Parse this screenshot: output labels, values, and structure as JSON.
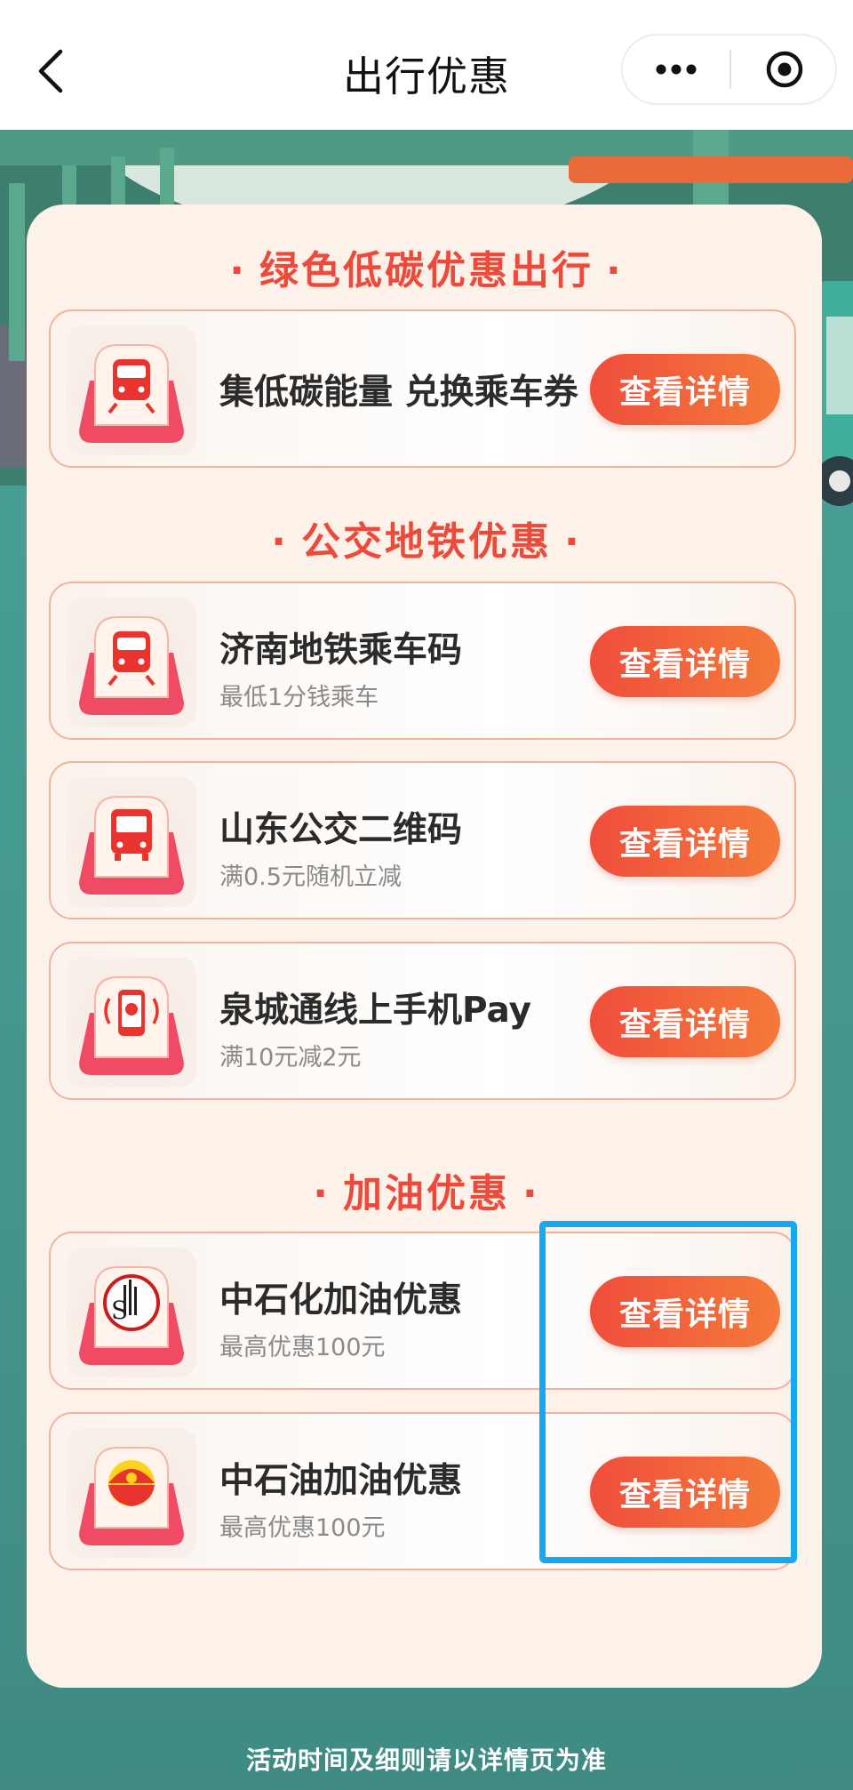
{
  "navbar": {
    "title": "出行优惠",
    "back_icon": "chevron-left-icon",
    "more_icon": "more-dots-icon",
    "close_icon": "close-circle-icon"
  },
  "sections": [
    {
      "title": "绿色低碳优惠出行",
      "items": [
        {
          "title": "集低碳能量 兑换乘车券",
          "subtitle": "",
          "button": "查看详情",
          "icon": "subway-icon"
        }
      ]
    },
    {
      "title": "公交地铁优惠",
      "items": [
        {
          "title": "济南地铁乘车码",
          "subtitle": "最低1分钱乘车",
          "button": "查看详情",
          "icon": "subway-icon"
        },
        {
          "title": "山东公交二维码",
          "subtitle": "满0.5元随机立减",
          "button": "查看详情",
          "icon": "bus-icon"
        },
        {
          "title": "泉城通线上手机Pay",
          "subtitle": "满10元减2元",
          "button": "查看详情",
          "icon": "phone-pay-icon"
        }
      ]
    },
    {
      "title": "加油优惠",
      "items": [
        {
          "title": "中石化加油优惠",
          "subtitle": "最高优惠100元",
          "button": "查看详情",
          "icon": "sinopec-logo-icon"
        },
        {
          "title": "中石油加油优惠",
          "subtitle": "最高优惠100元",
          "button": "查看详情",
          "icon": "petrochina-logo-icon"
        }
      ]
    }
  ],
  "footer": {
    "note": "活动时间及细则请以详情页为准"
  },
  "colors": {
    "accent": "#ec4b3b",
    "button_start": "#ef4e3c",
    "button_end": "#f57a3a",
    "card_bg": "#fcf2ea",
    "scene_bg": "#48a39b",
    "highlight": "#17a8f2"
  }
}
